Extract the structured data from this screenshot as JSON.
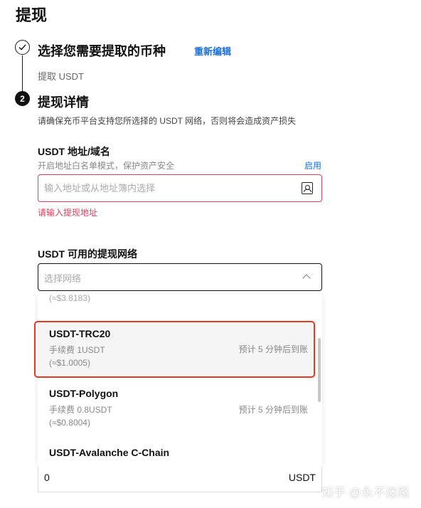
{
  "page": {
    "title": "提现"
  },
  "step1": {
    "title": "选择您需要提取的币种",
    "edit_link": "重新编辑",
    "selected": "提取 USDT"
  },
  "step2": {
    "number": "2",
    "title": "提现详情",
    "description": "请确保充币平台支持您所选择的 USDT 网络，否则将会造成资产损失"
  },
  "address": {
    "label": "USDT 地址/域名",
    "hint": "开启地址白名单模式，保护资产安全",
    "enable_link": "启用",
    "placeholder": "输入地址或从地址簿内选择",
    "error": "请输入提现地址"
  },
  "network": {
    "label": "USDT 可用的提现网络",
    "placeholder": "选择网络",
    "partial_above": "(≈$3.8183)",
    "options": [
      {
        "name": "USDT-TRC20",
        "fee": "手续费 1USDT",
        "usd": "(≈$1.0005)",
        "eta": "预计 5 分钟后到账"
      },
      {
        "name": "USDT-Polygon",
        "fee": "手续费 0.8USDT",
        "usd": "(≈$0.8004)",
        "eta": "预计 5 分钟后到账"
      },
      {
        "name": "USDT-Avalanche C-Chain"
      }
    ]
  },
  "amount": {
    "value": "0",
    "unit": "USDT"
  },
  "watermark": "知乎 @永不迷路",
  "colors": {
    "accent": "#1b6ee0",
    "error": "#e0405f",
    "highlight": "#e53a22"
  }
}
